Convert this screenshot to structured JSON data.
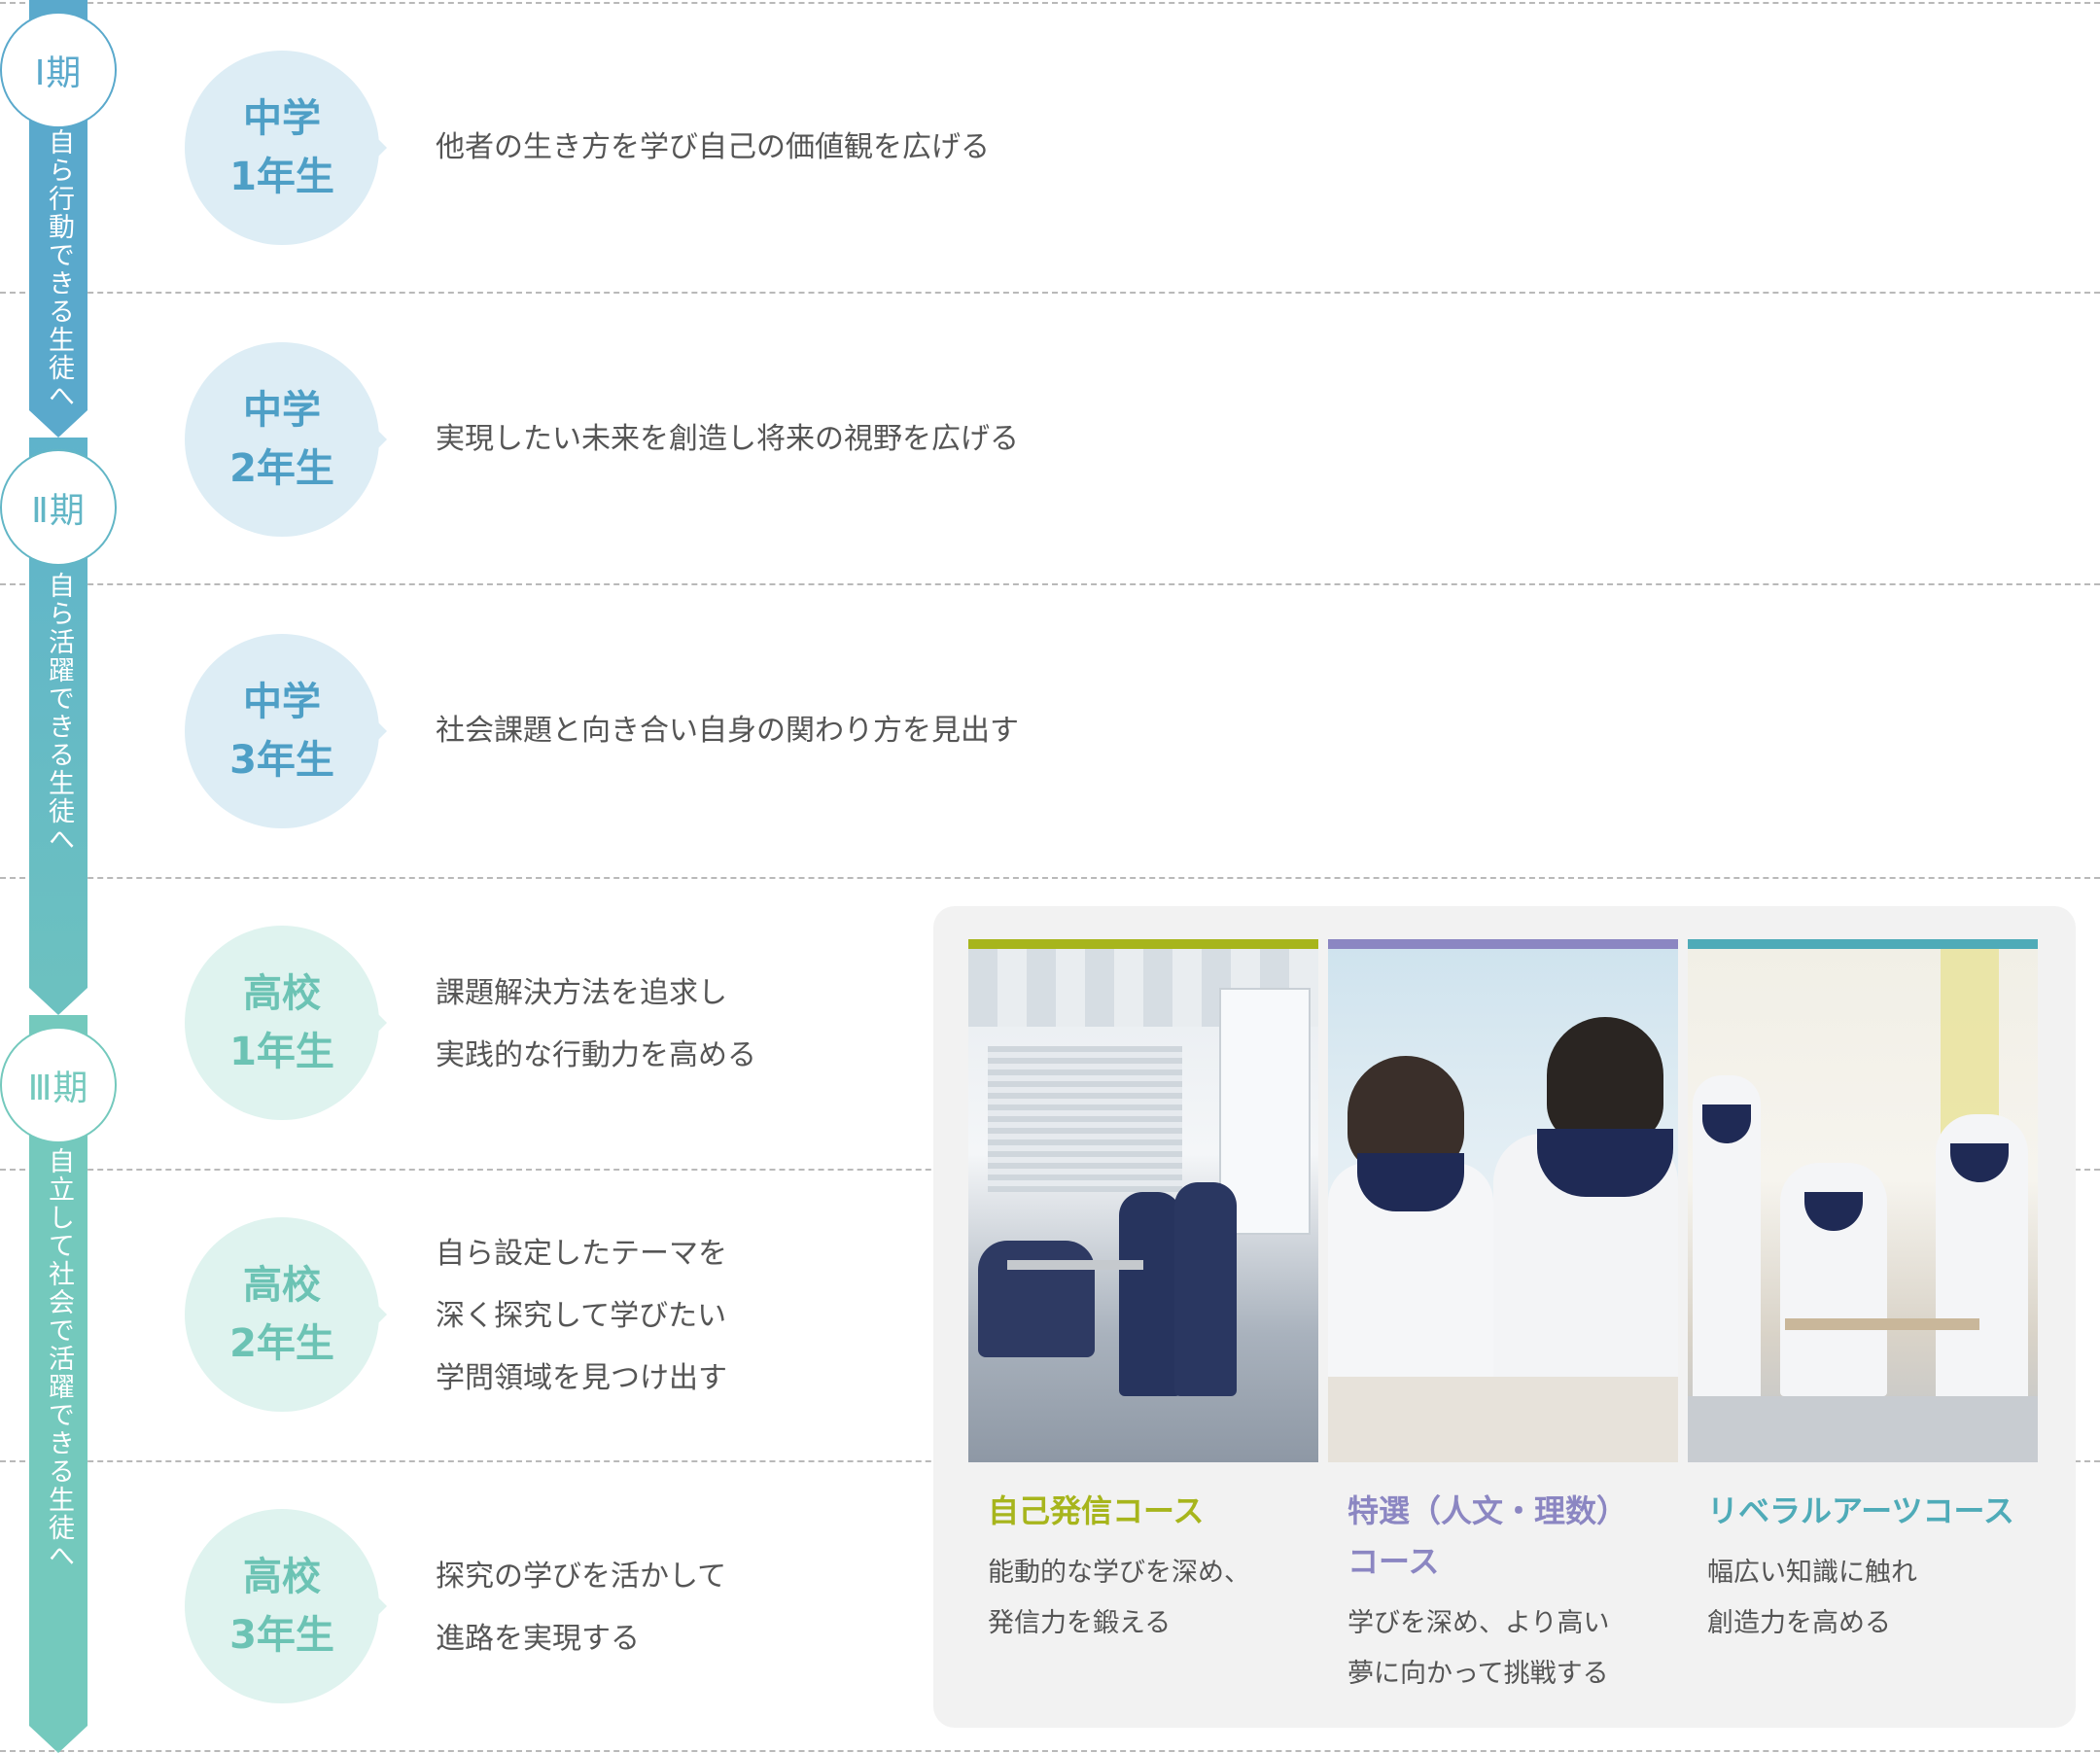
{
  "colors": {
    "phase1": "#5aa9cc",
    "phase2": "#6cc0c0",
    "phase3": "#74c9bd",
    "junior_disc": "#ddedf5",
    "junior_text": "#4e9fc6",
    "senior_disc": "#dff3ef",
    "senior_text": "#6cc3b4",
    "course1": "#a7b51c",
    "course2": "#8b86c2",
    "course3": "#4fabb8"
  },
  "phases": [
    {
      "label": "Ⅰ期",
      "tagline": "自ら行動できる生徒へ"
    },
    {
      "label": "Ⅱ期",
      "tagline": "自ら活躍できる生徒へ"
    },
    {
      "label": "Ⅲ期",
      "tagline": "自立して社会で活躍できる生徒へ"
    }
  ],
  "grades": [
    {
      "school": "中学",
      "year": "1年生",
      "lines": [
        "他者の生き方を学び自己の価値観を広げる"
      ]
    },
    {
      "school": "中学",
      "year": "2年生",
      "lines": [
        "実現したい未来を創造し将来の視野を広げる"
      ]
    },
    {
      "school": "中学",
      "year": "3年生",
      "lines": [
        "社会課題と向き合い自身の関わり方を見出す"
      ]
    },
    {
      "school": "高校",
      "year": "1年生",
      "lines": [
        "課題解決方法を追求し",
        "実践的な行動力を高める"
      ]
    },
    {
      "school": "高校",
      "year": "2年生",
      "lines": [
        "自ら設定したテーマを",
        "深く探究して学びたい",
        "学問領域を見つけ出す"
      ]
    },
    {
      "school": "高校",
      "year": "3年生",
      "lines": [
        "探究の学びを活かして",
        "進路を実現する"
      ]
    }
  ],
  "courses": [
    {
      "name_lines": [
        "自己発信コース"
      ],
      "desc_lines": [
        "能動的な学びを深め、",
        "発信力を鍛える"
      ]
    },
    {
      "name_lines": [
        "特選（人文・理数）",
        "コース"
      ],
      "desc_lines": [
        "学びを深め、より高い",
        "夢に向かって挑戦する"
      ]
    },
    {
      "name_lines": [
        "リベラルアーツコース"
      ],
      "desc_lines": [
        "幅広い知識に触れ",
        "創造力を高める"
      ]
    }
  ]
}
